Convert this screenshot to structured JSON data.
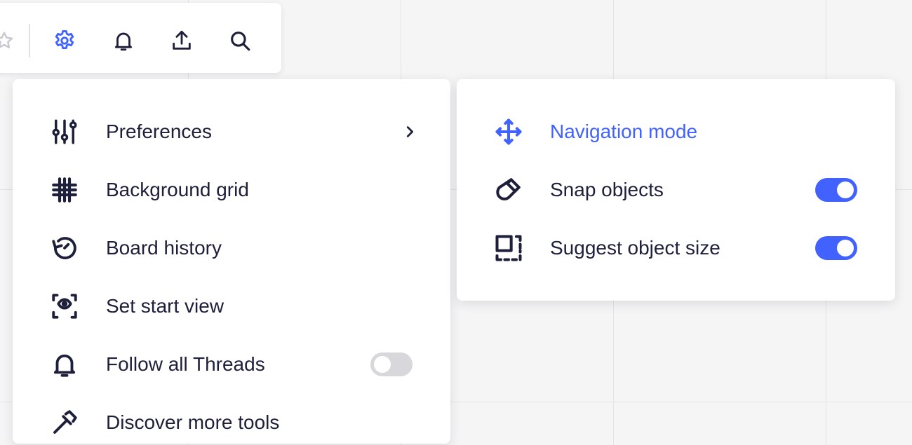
{
  "toolbar": {
    "icons": [
      "star-icon",
      "settings-gear-icon",
      "bell-icon",
      "upload-icon",
      "search-icon"
    ],
    "active_color": "#4262ff"
  },
  "menu": {
    "items": [
      {
        "label": "Preferences",
        "icon": "sliders-icon",
        "has_submenu": true
      },
      {
        "label": "Background grid",
        "icon": "grid-icon"
      },
      {
        "label": "Board history",
        "icon": "history-icon"
      },
      {
        "label": "Set start view",
        "icon": "start-view-eye-icon"
      },
      {
        "label": "Follow all Threads",
        "icon": "bell-icon",
        "toggle": false
      },
      {
        "label": "Discover more tools",
        "icon": "tools-icon"
      }
    ]
  },
  "submenu": {
    "items": [
      {
        "label": "Navigation mode",
        "icon": "move-arrows-icon",
        "active": true
      },
      {
        "label": "Snap objects",
        "icon": "magnet-icon",
        "toggle": true
      },
      {
        "label": "Suggest object size",
        "icon": "object-size-icon",
        "toggle": true
      }
    ]
  },
  "colors": {
    "accent": "#4262ff",
    "text": "#1e1f3a",
    "toggle_off": "#d7d7dc"
  }
}
